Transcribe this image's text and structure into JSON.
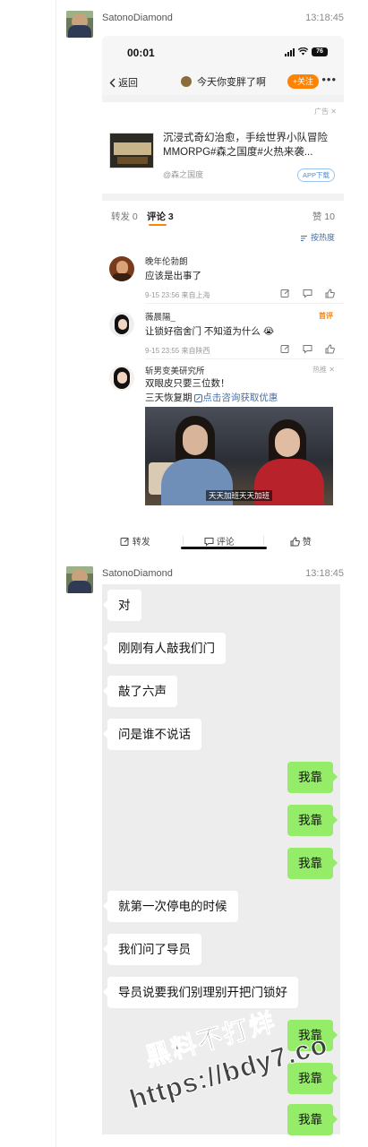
{
  "post1": {
    "username": "SatonoDiamond",
    "time": "13:18:45",
    "screenshot": {
      "status": {
        "time": "00:01",
        "battery": "76"
      },
      "nav": {
        "back": "返回",
        "title": "今天你变胖了啊",
        "follow": "+关注"
      },
      "ad": {
        "tag": "广告",
        "title": "沉浸式奇幻治愈，手绘世界小队冒险MMORPG#森之国度#火热来袭...",
        "source": "@森之国度",
        "download": "APP下载"
      },
      "tabs": {
        "repost": "转发 0",
        "comment": "评论 3",
        "likes": "赞 10"
      },
      "sort": "按热度",
      "comments": [
        {
          "name": "晚年伦勃朗",
          "text": "应该是出事了",
          "meta": "9-15 23:56  来自上海"
        },
        {
          "name": "薇晨陽_",
          "text": "让锁好宿舍门 不知道为什么",
          "emoji": "😭",
          "meta": "9-15 23:55  来自陕西",
          "tag": "首评"
        },
        {
          "name": "斩男变美研究所",
          "text_line1": "双眼皮只要三位数！",
          "text_line2": "三天恢复期",
          "link": "点击咨询获取优惠",
          "hot": "热推",
          "video_subtitle": "天天加班天天加班"
        }
      ],
      "actions": {
        "repost": "转发",
        "comment": "评论",
        "like": "赞"
      }
    }
  },
  "post2": {
    "username": "SatonoDiamond",
    "time": "13:18:45",
    "messages": [
      {
        "side": "in",
        "text": "对"
      },
      {
        "side": "in",
        "text": "刚刚有人敲我们门"
      },
      {
        "side": "in",
        "text": "敲了六声"
      },
      {
        "side": "in",
        "text": "问是谁不说话"
      },
      {
        "side": "out",
        "text": "我靠"
      },
      {
        "side": "out",
        "text": "我靠"
      },
      {
        "side": "out",
        "text": "我靠"
      },
      {
        "side": "in",
        "text": "就第一次停电的时候"
      },
      {
        "side": "in",
        "text": "我们问了导员"
      },
      {
        "side": "in",
        "text": "导员说要我们别理别开把门锁好"
      },
      {
        "side": "out",
        "text": "我靠"
      },
      {
        "side": "out",
        "text": "我靠"
      },
      {
        "side": "out",
        "text": "我靠"
      }
    ]
  },
  "watermark": {
    "line1": "黑料不打烊",
    "line2": "https://bdy7.co"
  },
  "colors": {
    "accent": "#ff8200",
    "bubble_out": "#95ec69",
    "bubble_in": "#ffffff",
    "chat_bg": "#ededed",
    "link": "#4a6fa5"
  }
}
